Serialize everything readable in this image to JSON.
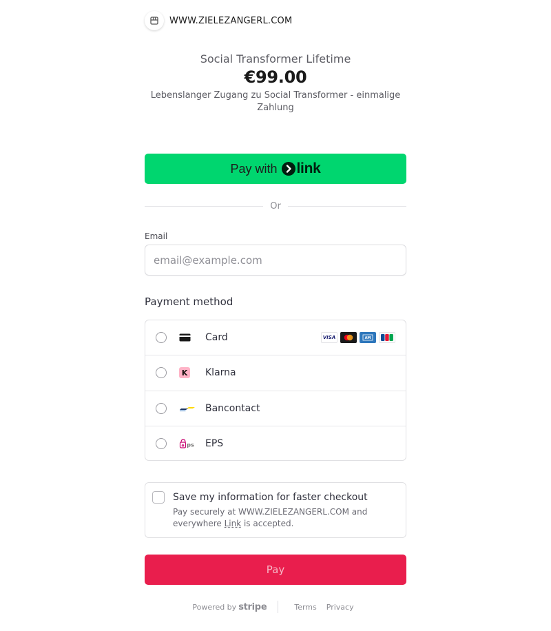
{
  "merchant": {
    "name": "WWW.ZIELEZANGERL.COM",
    "icon": "store-icon"
  },
  "product": {
    "name": "Social Transformer Lifetime",
    "price": "€99.00",
    "description": "Lebenslanger Zugang zu Social Transformer - einmalige Zahlung"
  },
  "link_button": {
    "prefix": "Pay with",
    "brand": "link",
    "color": "#00d66f"
  },
  "divider": {
    "text": "Or"
  },
  "email": {
    "label": "Email",
    "placeholder": "email@example.com",
    "value": ""
  },
  "payment_method": {
    "title": "Payment method",
    "options": [
      {
        "label": "Card",
        "icon": "card-icon",
        "selected": false,
        "brands": [
          "VISA",
          "mastercard",
          "amex",
          "JCB"
        ]
      },
      {
        "label": "Klarna",
        "icon": "klarna-icon",
        "selected": false
      },
      {
        "label": "Bancontact",
        "icon": "bancontact-icon",
        "selected": false
      },
      {
        "label": "EPS",
        "icon": "eps-icon",
        "selected": false
      }
    ]
  },
  "save_info": {
    "checked": false,
    "title": "Save my information for faster checkout",
    "sub_before": "Pay securely at WWW.ZIELEZANGERL.COM and everywhere ",
    "sub_link": "Link",
    "sub_after": " is accepted."
  },
  "pay_button": {
    "label": "Pay",
    "color": "#e91e4d"
  },
  "footer": {
    "powered_by": "Powered by",
    "brand": "stripe",
    "terms": "Terms",
    "privacy": "Privacy"
  }
}
